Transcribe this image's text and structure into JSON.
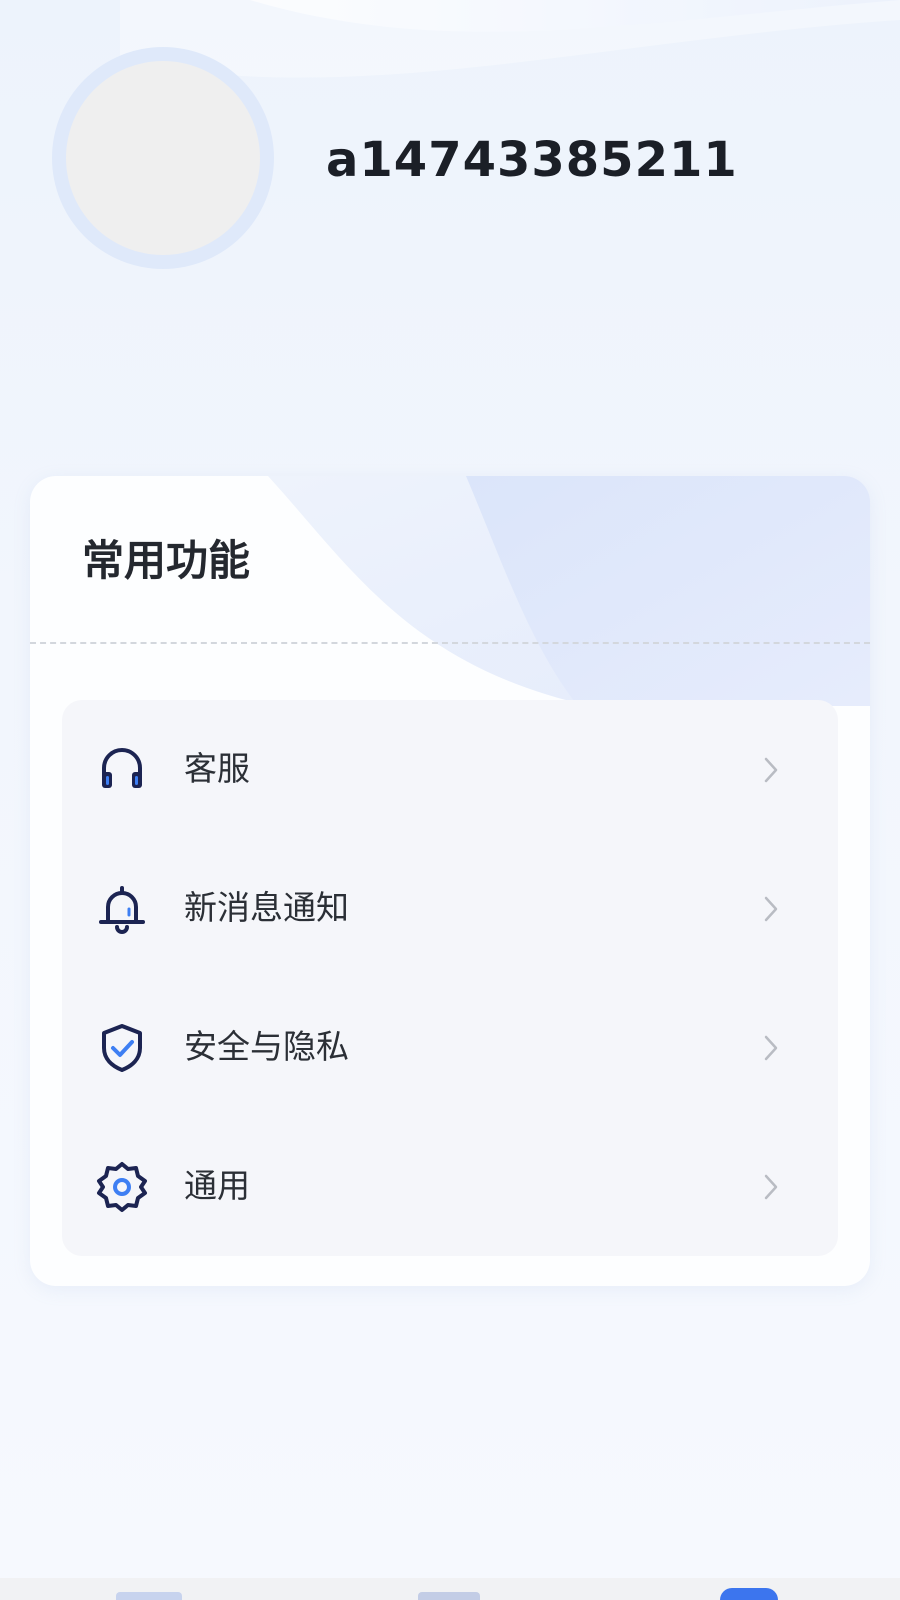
{
  "profile": {
    "username": "a14743385211"
  },
  "common_functions": {
    "title": "常用功能",
    "items": [
      {
        "label": "客服",
        "icon": "headset-icon"
      },
      {
        "label": "新消息通知",
        "icon": "bell-icon"
      },
      {
        "label": "安全与隐私",
        "icon": "shield-check-icon"
      },
      {
        "label": "通用",
        "icon": "gear-icon"
      }
    ]
  },
  "tabbar": {
    "tabs": [
      {
        "icon": "tab-1-icon"
      },
      {
        "icon": "tab-2-icon"
      },
      {
        "icon": "tab-3-icon",
        "active": true
      }
    ]
  },
  "colors": {
    "icon_navy": "#1c2452",
    "icon_blue": "#3e7ff3",
    "accent_blue": "#3c75ee",
    "background": "#f2f6fd"
  }
}
